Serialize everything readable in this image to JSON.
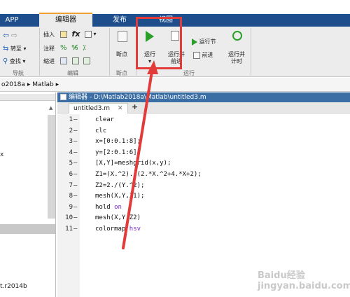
{
  "tabs": [
    {
      "label": "APP"
    },
    {
      "label": "编辑器"
    },
    {
      "label": "发布"
    },
    {
      "label": "视图"
    }
  ],
  "ribbon": {
    "insert": "插入",
    "comment": "注释",
    "indent": "缩进",
    "goto": "转至",
    "find": "查找",
    "nav_group": "导航",
    "edit_group": "编辑",
    "breakpoint": "断点",
    "breakpoint_group": "断点",
    "run": "运行",
    "run_advance_1": "运行并",
    "run_advance_2": "前进",
    "run_section": "运行节",
    "advance": "前进",
    "run_time_1": "运行并",
    "run_time_2": "计时",
    "run_group": "运行"
  },
  "address": {
    "path_part1": "o2018a",
    "path_part2": "Matlab"
  },
  "leftpanel": {
    "item_x": "x",
    "item_bottom": "t.r2014b"
  },
  "editor": {
    "title": "编辑器 - D:\\Matlab2018a\\Matlab\\untitled3.m",
    "tab_name": "untitled3.m",
    "lines": [
      {
        "no": "1",
        "code": "clear"
      },
      {
        "no": "2",
        "code": "clc"
      },
      {
        "no": "3",
        "code": "x=[0:0.1:8];"
      },
      {
        "no": "4",
        "code": "y=[2:0.1:6];"
      },
      {
        "no": "5",
        "code": "[X,Y]=meshgrid(x,y);"
      },
      {
        "no": "6",
        "code": "Z1=(X.^2)./(2.*X.^2+4.*X+2);"
      },
      {
        "no": "7",
        "code": "Z2=2./(Y.^2);"
      },
      {
        "no": "8",
        "code": "mesh(X,Y,Z1);"
      },
      {
        "no": "9",
        "code": "hold ",
        "kw": "on"
      },
      {
        "no": "10",
        "code": "mesh(X,Y,Z2)"
      },
      {
        "no": "11",
        "code": "colormap ",
        "kw": "hsv"
      }
    ]
  },
  "colors": {
    "tab_bar": "#1f4e8c",
    "annotation_red": "#e33a3a",
    "run_green": "#2aa02a",
    "keyword_purple": "#7a2bd0"
  },
  "watermark": "Baidu经验 jingyan.baidu.com"
}
